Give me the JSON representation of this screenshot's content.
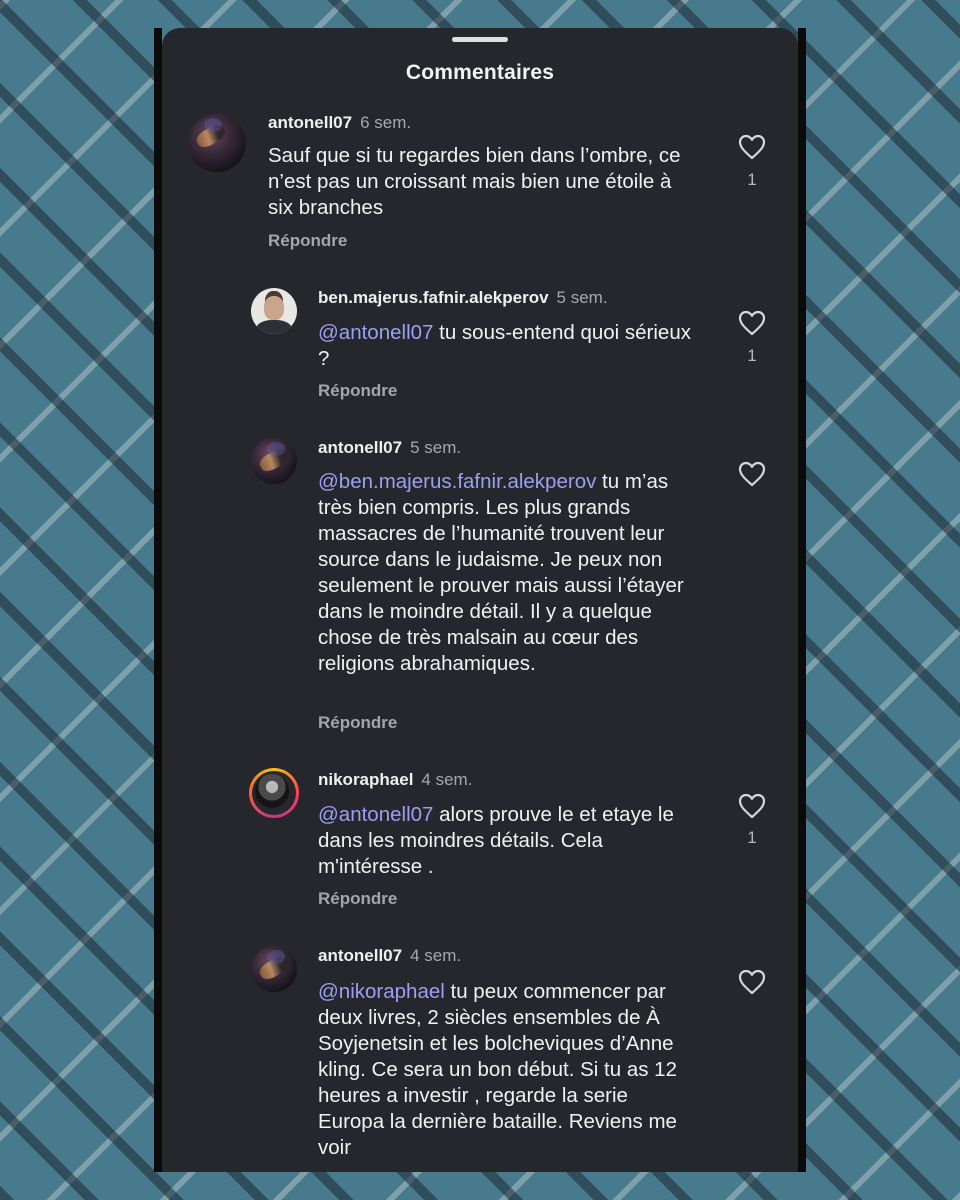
{
  "sheet": {
    "title": "Commentaires"
  },
  "comments": [
    {
      "username": "antonell07",
      "time": "6 sem.",
      "mention": "",
      "text": "Sauf que si tu regardes bien dans l’ombre, ce n’est pas un croissant mais bien une étoile à six branches",
      "reply": "Répondre",
      "likes": "1",
      "avatar_icon": "avatar-antonell07"
    },
    {
      "username": "ben.majerus.fafnir.alekperov",
      "time": "5 sem.",
      "mention": "@antonell07",
      "text": " tu sous-entend quoi sérieux ?",
      "reply": "Répondre",
      "likes": "1",
      "avatar_icon": "avatar-ben"
    },
    {
      "username": "antonell07",
      "time": "5 sem.",
      "mention": "@ben.majerus.fafnir.alekperov",
      "text": " tu m’as très bien compris. Les plus grands massacres de l’humanité trouvent leur source dans le judaisme. Je peux non seulement le prouver mais aussi l’étayer dans le moindre détail. Il y a quelque chose de très malsain au cœur des religions abrahamiques.",
      "reply": "Répondre",
      "likes": "",
      "avatar_icon": "avatar-antonell07"
    },
    {
      "username": "nikoraphael",
      "time": "4 sem.",
      "mention": "@antonell07",
      "text": " alors prouve le et etaye le dans les moindres détails. Cela m'intéresse .",
      "reply": "Répondre",
      "likes": "1",
      "avatar_icon": "avatar-nikoraphael"
    },
    {
      "username": "antonell07",
      "time": "4 sem.",
      "mention": "@nikoraphael",
      "text": "  tu peux commencer par deux livres, 2 siècles ensembles de À Soyjenetsin et les bolcheviques d’Anne kling. Ce sera un bon début. Si tu as 12 heures a investir , regarde la serie Europa la dernière bataille. Reviens me voir",
      "reply": "",
      "likes": "",
      "avatar_icon": "avatar-antonell07"
    }
  ],
  "colors": {
    "sheet_bg": "#25272d",
    "mention": "#9d9ff2",
    "muted": "#a6a8ad",
    "pattern_bg": "#477a8d"
  }
}
